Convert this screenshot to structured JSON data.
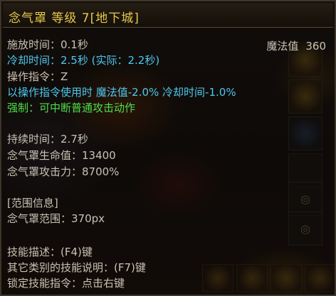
{
  "skill": {
    "title": "念气罩 等级 7[地下城]"
  },
  "mana": {
    "label": "魔法值",
    "value": "360"
  },
  "lines": {
    "cast_time": "施放时间：0.1秒",
    "cooldown": "冷却时间：2.5秒 (实际：2.2秒)",
    "command": "操作指令：Z",
    "command_bonus": "以操作指令使用时 魔法值-2.0% 冷却时间-1.0%",
    "force": "强制：可中断普通攻击动作",
    "duration": "持续时间：2.7秒",
    "shield_hp": "念气罩生命值：13400",
    "shield_atk": "念气罩攻击力：8700%",
    "range_header": "[范围信息]",
    "shield_range": "念气罩范围：370px",
    "desc_key": "技能描述：(F4)键",
    "other_key": "其它类别的技能说明：(F7)键",
    "lock_key": "锁定技能指令：点击右键"
  },
  "colors": {
    "title": "#e8c84a",
    "normal": "#c9c2b4",
    "highlight": "#4ec8ef",
    "positive": "#4fde4a"
  },
  "icons": {
    "side_slot_glyph": "◎"
  }
}
